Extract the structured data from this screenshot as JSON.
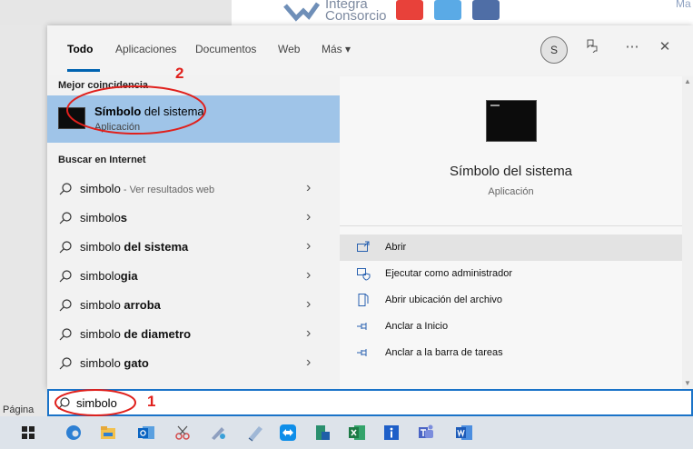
{
  "background": {
    "logo_text_top": "Integra",
    "logo_text_bottom": "Consorcio",
    "right_text": "Ma",
    "page_label": "Página"
  },
  "tabs": [
    "Todo",
    "Aplicaciones",
    "Documentos",
    "Web",
    "Más ▾"
  ],
  "avatar_initial": "S",
  "best_match": {
    "section_label": "Mejor coincidencia",
    "title_bold": "Símbolo",
    "title_rest": " del sistema",
    "subtitle": "Aplicación"
  },
  "web_section_label": "Buscar en Internet",
  "web_results": [
    {
      "plain": "simbolo",
      "bold": "",
      "hint": " - Ver resultados web"
    },
    {
      "plain": "simbolo",
      "bold": "s",
      "hint": ""
    },
    {
      "plain": "simbolo ",
      "bold": "del sistema",
      "hint": ""
    },
    {
      "plain": "simbolo",
      "bold": "gia",
      "hint": ""
    },
    {
      "plain": "simbolo ",
      "bold": "arroba",
      "hint": ""
    },
    {
      "plain": "simbolo ",
      "bold": "de diametro",
      "hint": ""
    },
    {
      "plain": "simbolo ",
      "bold": "gato",
      "hint": ""
    }
  ],
  "detail": {
    "title": "Símbolo del sistema",
    "subtitle": "Aplicación",
    "actions": [
      {
        "label": "Abrir",
        "icon": "open-icon"
      },
      {
        "label": "Ejecutar como administrador",
        "icon": "run-as-admin-icon"
      },
      {
        "label": "Abrir ubicación del archivo",
        "icon": "file-location-icon"
      },
      {
        "label": "Anclar a Inicio",
        "icon": "pin-icon"
      },
      {
        "label": "Anclar a la barra de tareas",
        "icon": "pin-icon"
      }
    ]
  },
  "search": {
    "value": "simbolo"
  },
  "annotations": {
    "one": "1",
    "two": "2"
  },
  "colors": {
    "accent": "#0063b1",
    "highlight": "#9fc4e8",
    "annotation": "#e0201c"
  }
}
